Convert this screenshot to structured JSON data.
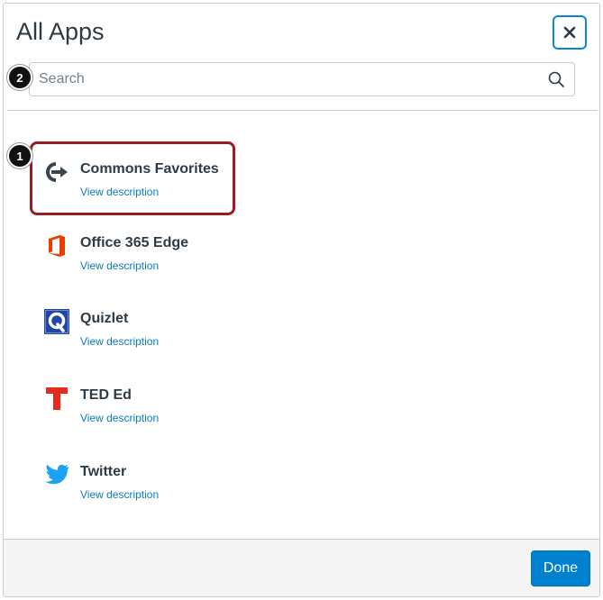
{
  "dialog": {
    "title": "All Apps",
    "close_label": "×"
  },
  "search": {
    "placeholder": "Search",
    "value": ""
  },
  "callouts": [
    "1",
    "2"
  ],
  "apps": [
    {
      "name": "Commons Favorites",
      "link": "View description",
      "icon": "commons-arrow-icon"
    },
    {
      "name": "Office 365 Edge",
      "link": "View description",
      "icon": "office-365-icon"
    },
    {
      "name": "Quizlet",
      "link": "View description",
      "icon": "quizlet-icon"
    },
    {
      "name": "TED Ed",
      "link": "View description",
      "icon": "ted-ed-icon"
    },
    {
      "name": "Twitter",
      "link": "View description",
      "icon": "twitter-bird-icon"
    }
  ],
  "footer": {
    "done_label": "Done"
  },
  "colors": {
    "accent": "#0081cf",
    "link": "#0a7bc3",
    "highlight": "#9b1b24",
    "office": "#eb3c00",
    "ted": "#e62b1e",
    "quizlet": "#2046a6",
    "twitter": "#1da1f2"
  }
}
